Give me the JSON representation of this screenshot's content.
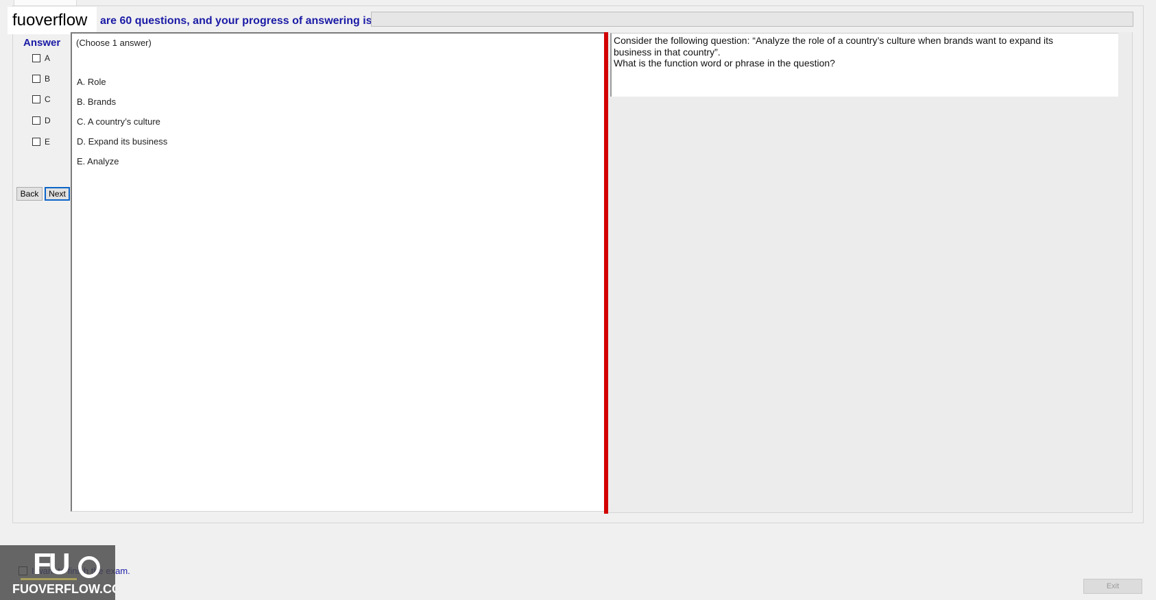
{
  "watermark": {
    "top_text": "fuoverflow",
    "logo_mark": "FUO",
    "logo_text": "FUOVERFLOW.COM"
  },
  "header": {
    "progress_text": "are 60 questions, and your progress of answering is"
  },
  "sidebar": {
    "title": "Answer",
    "options": [
      {
        "label": "A",
        "checked": false
      },
      {
        "label": "B",
        "checked": false
      },
      {
        "label": "C",
        "checked": false
      },
      {
        "label": "D",
        "checked": false
      },
      {
        "label": "E",
        "checked": false
      }
    ],
    "back_label": "Back",
    "next_label": "Next"
  },
  "choices": {
    "note": "(Choose 1 answer)",
    "items": [
      "A.  Role",
      "B.  Brands",
      "C.  A country’s culture",
      "D.  Expand its business",
      "E.  Analyze"
    ]
  },
  "question": {
    "lines": [
      "Consider the following question: “Analyze the role of a country’s culture when brands want to expand its",
      "business in that country”.",
      "What is the function word or phrase in the question?"
    ]
  },
  "footer": {
    "finish_label": "I want to finish the exam.",
    "finish_checked": false,
    "exit_label": "Exit"
  },
  "colors": {
    "accent_blue": "#1a1aa6",
    "divider_red": "#d20000",
    "focus_blue": "#0a64c8"
  }
}
